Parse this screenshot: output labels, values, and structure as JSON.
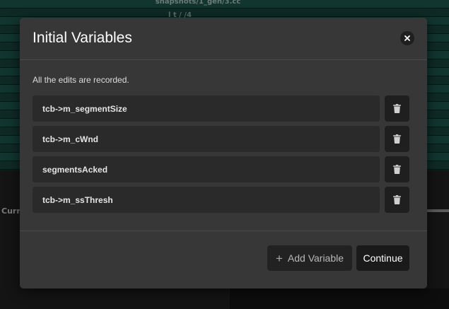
{
  "background": {
    "file_label_top": "snapshots/1_gen/3.cc",
    "file_label_second": "l    t    /    /4",
    "current_label": "Curr"
  },
  "modal": {
    "title": "Initial Variables",
    "close_icon": "close-icon",
    "info_text": "All the edits are recorded.",
    "variables": [
      {
        "name": "tcb->m_segmentSize"
      },
      {
        "name": "tcb->m_cWnd"
      },
      {
        "name": "segmentsAcked"
      },
      {
        "name": "tcb->m_ssThresh"
      }
    ],
    "delete_icon": "trash-icon",
    "add_button": {
      "icon": "plus-icon",
      "label": "Add Variable"
    },
    "continue_button": {
      "label": "Continue"
    }
  },
  "colors": {
    "modal_bg": "#373737",
    "field_bg": "#2a2a2a",
    "button_bg": "#1f1f1f",
    "backdrop_teal": "#0f2a25"
  }
}
